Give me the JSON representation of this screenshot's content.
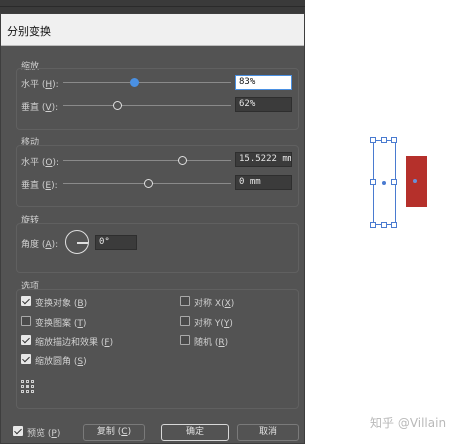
{
  "window": {
    "title": "分别变换"
  },
  "scale": {
    "title": "缩放",
    "horizontal": {
      "label": "水平",
      "key": "H",
      "value": "83%"
    },
    "vertical": {
      "label": "垂直",
      "key": "V",
      "value": "62%"
    }
  },
  "move": {
    "title": "移动",
    "horizontal": {
      "label": "水平",
      "key": "O",
      "value": "15.5222 mm"
    },
    "vertical": {
      "label": "垂直",
      "key": "E",
      "value": "0 mm"
    }
  },
  "rotate": {
    "title": "旋转",
    "angle": {
      "label": "角度",
      "key": "A",
      "value": "0°"
    }
  },
  "options": {
    "title": "选项",
    "transform_objects": {
      "label": "变换对象",
      "key": "B",
      "checked": true
    },
    "transform_patterns": {
      "label": "变换图案",
      "key": "T",
      "checked": false
    },
    "scale_strokes": {
      "label": "缩放描边和效果",
      "key": "F",
      "checked": true
    },
    "scale_corners": {
      "label": "缩放圆角",
      "key": "S",
      "checked": true
    },
    "reflect_x": {
      "label": "对称",
      "key": "X",
      "checked": false
    },
    "reflect_y": {
      "label": "对称",
      "key": "Y",
      "checked": false
    },
    "random": {
      "label": "随机",
      "key": "R",
      "checked": false
    }
  },
  "footer": {
    "preview": {
      "label": "预览",
      "key": "P",
      "checked": true
    },
    "copy_button": "复制",
    "copy_key": "C",
    "ok_button": "确定",
    "cancel_button": "取消"
  },
  "slider_levels": {
    "scale_horizontal": 0.83,
    "scale_vertical": 0.62
  },
  "watermark": "知乎 @Villain",
  "colors": {
    "accent": "#4a90e2",
    "object_fill": "#b5302b",
    "dialog_bg": "#535353"
  }
}
